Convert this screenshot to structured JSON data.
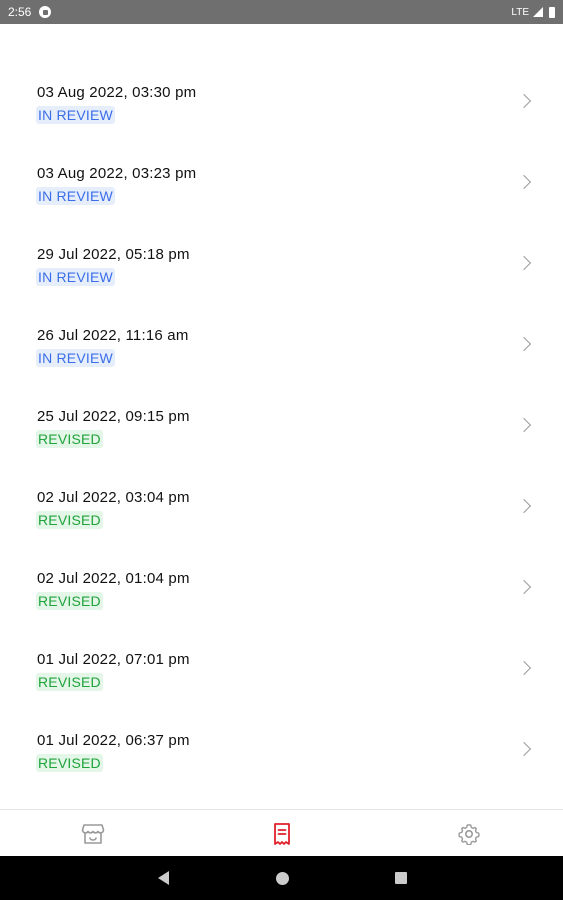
{
  "status_bar": {
    "time": "2:56",
    "network": "LTE"
  },
  "orders": [
    {
      "date": "03 Aug 2022, 03:30 pm",
      "status": "IN REVIEW"
    },
    {
      "date": "03 Aug 2022, 03:23 pm",
      "status": "IN REVIEW"
    },
    {
      "date": "29 Jul 2022, 05:18 pm",
      "status": "IN REVIEW"
    },
    {
      "date": "26 Jul 2022, 11:16 am",
      "status": "IN REVIEW"
    },
    {
      "date": "25 Jul 2022, 09:15 pm",
      "status": "REVISED"
    },
    {
      "date": "02 Jul 2022, 03:04 pm",
      "status": "REVISED"
    },
    {
      "date": "02 Jul 2022, 01:04 pm",
      "status": "REVISED"
    },
    {
      "date": "01 Jul 2022, 07:01 pm",
      "status": "REVISED"
    },
    {
      "date": "01 Jul 2022, 06:37 pm",
      "status": "REVISED"
    }
  ],
  "colors": {
    "in_review_text": "#3b6ee8",
    "in_review_bg": "#e6eefc",
    "revised_text": "#1fa33b",
    "revised_bg": "#e3f6e7",
    "active_tab": "#e0202a",
    "inactive_tab": "#9a9a9a"
  },
  "bottom_nav": [
    {
      "icon": "store-icon",
      "active": false
    },
    {
      "icon": "orders-icon",
      "active": true
    },
    {
      "icon": "settings-icon",
      "active": false
    }
  ]
}
